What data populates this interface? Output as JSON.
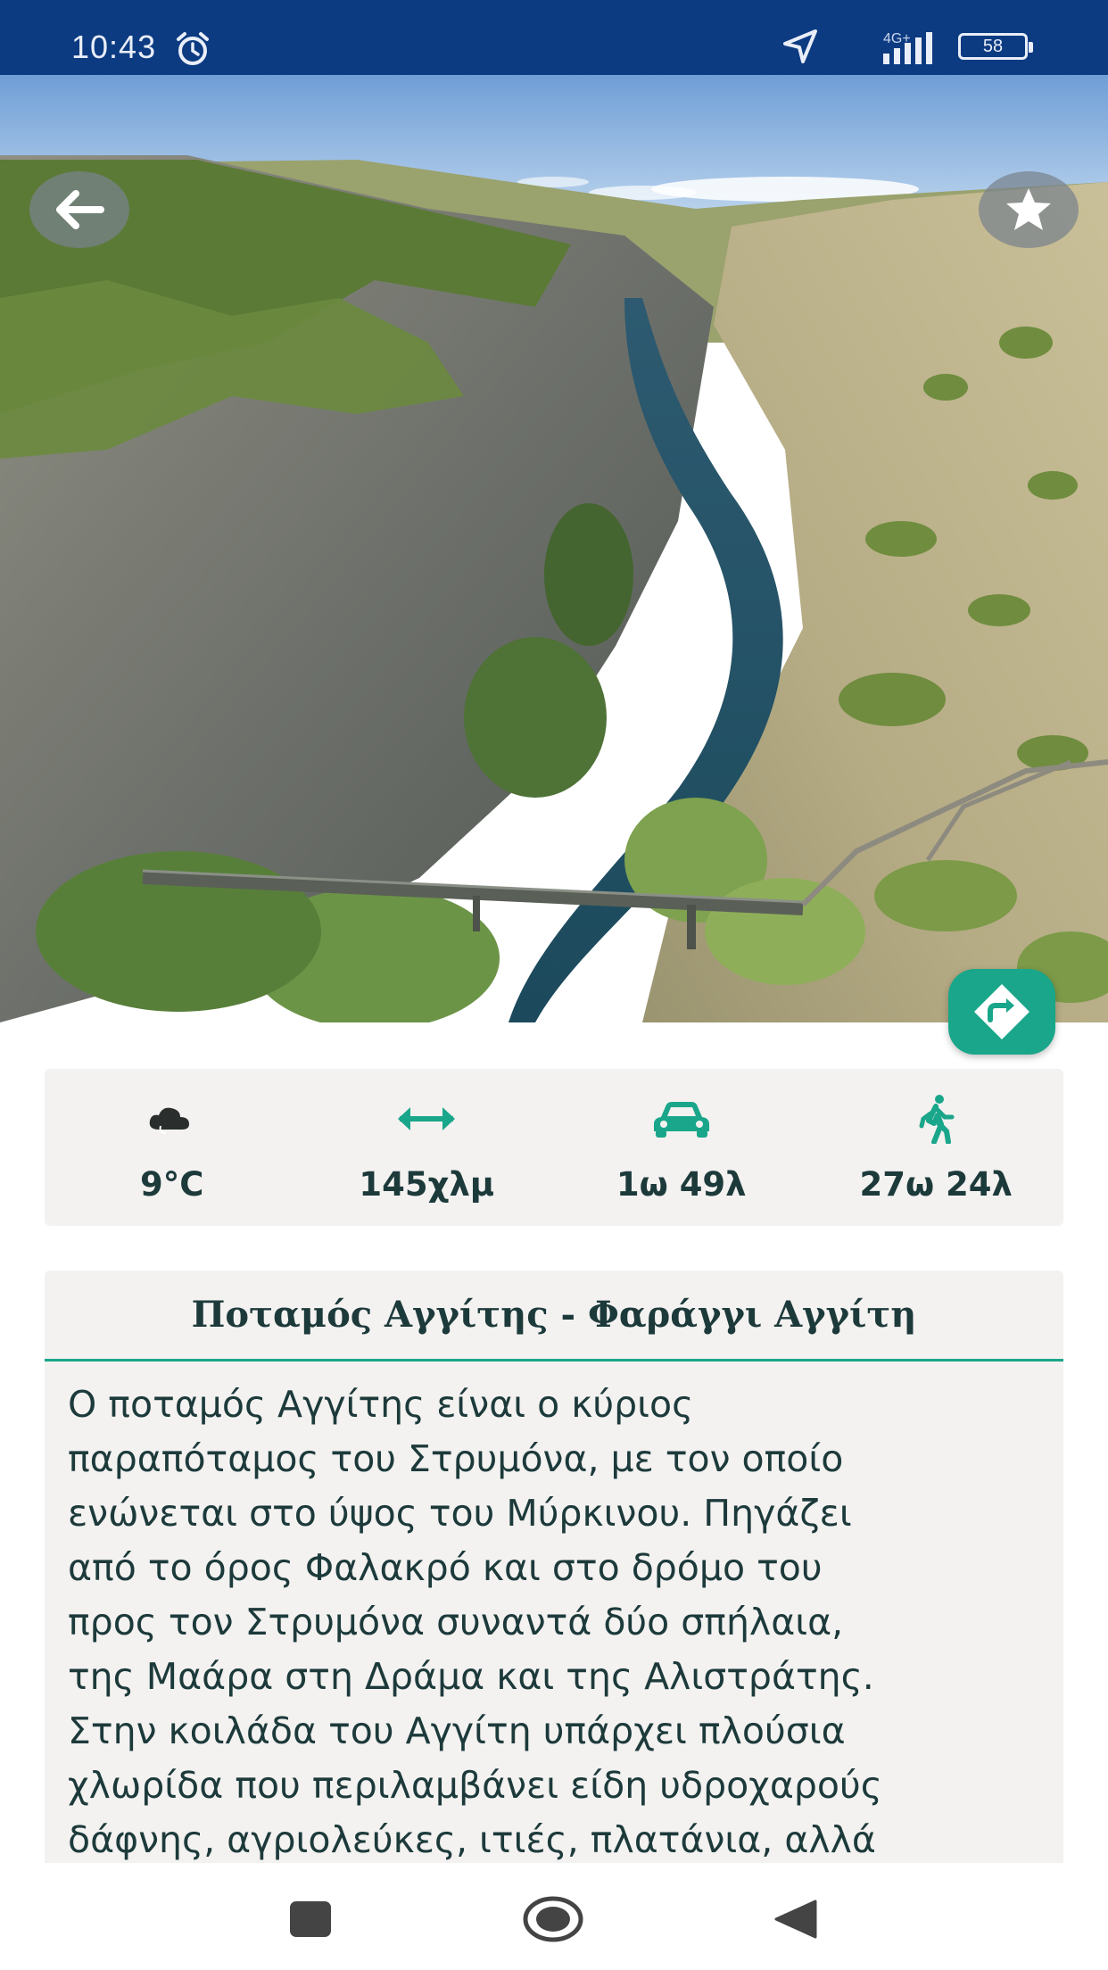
{
  "status_bar": {
    "time": "10:43",
    "network": "4G+",
    "battery": "58",
    "icons": [
      "alarm-icon",
      "location-arrow-icon",
      "signal-icon",
      "battery-icon"
    ]
  },
  "hero": {
    "icons": [
      "back-arrow-icon",
      "star-icon",
      "directions-icon"
    ]
  },
  "stats": [
    {
      "icon": "weather-cloud-icon",
      "value": "9°C"
    },
    {
      "icon": "distance-arrows-icon",
      "value": "145χλμ"
    },
    {
      "icon": "car-icon",
      "value": "1ω 49λ"
    },
    {
      "icon": "walking-person-icon",
      "value": "27ω 24λ"
    }
  ],
  "place": {
    "title": "Ποταμός Αγγίτης - Φαράγγι Αγγίτη",
    "description": "Ο ποταμός Αγγίτης είναι ο κύριος\nπαραπόταμος του Στρυμόνα, με τον οποίο\nενώνεται στο ύψος του Μύρκινου. Πηγάζει\nαπό το όρος Φαλακρό και στο δρόμο του\nπρος τον Στρυμόνα συναντά δύο σπήλαια,\nτης Μαάρα στη Δράμα και της Αλιστράτης.\nΣτην κοιλάδα του Αγγίτη υπάρχει πλούσια\nχλωρίδα που περιλαμβάνει  είδη υδροχαρούς\nδάφνης, αγριολεύκες, ιτιές, πλατάνια, αλλά"
  },
  "nav_bar": {
    "icons": [
      "recents-square-icon",
      "home-circle-icon",
      "back-triangle-icon"
    ]
  },
  "colors": {
    "accent": "#1aa68a",
    "status_bar": "#0d3b82",
    "text_dark": "#1d3a3b",
    "card_bg": "#f3f2f0"
  }
}
